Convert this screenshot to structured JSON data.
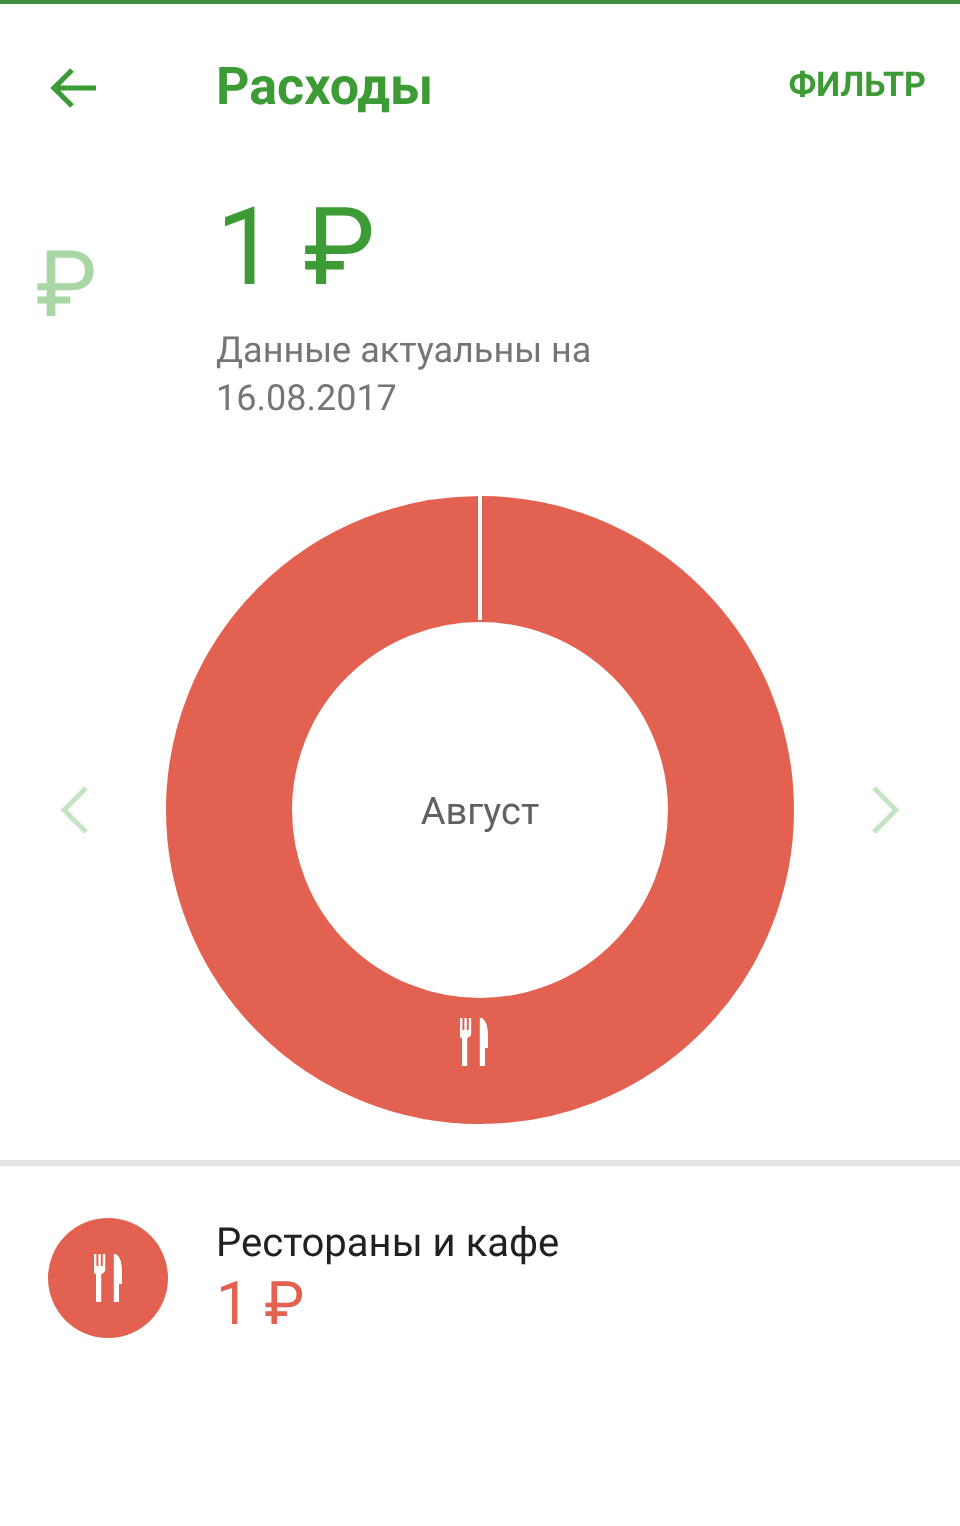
{
  "header": {
    "title": "Расходы",
    "action": "ФИЛЬТР"
  },
  "summary": {
    "previous_amount": "₽",
    "amount": "1 ₽",
    "note": "Данные актуальны на 16.08.2017"
  },
  "donut": {
    "center_label": "Август"
  },
  "categories": [
    {
      "name": "Рестораны и кафе",
      "amount": "1 ₽",
      "color": "#e36150"
    }
  ]
}
